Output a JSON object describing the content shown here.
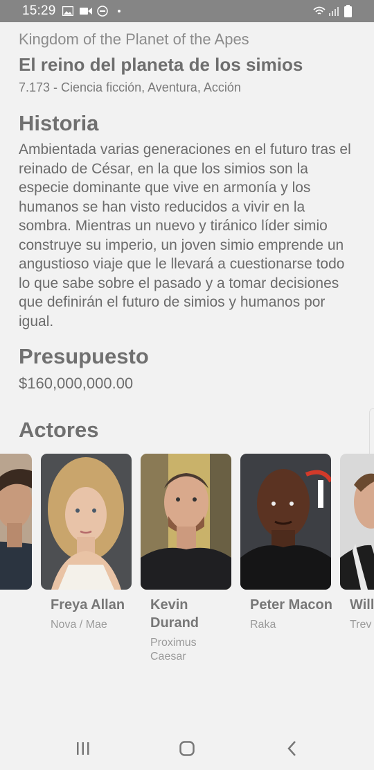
{
  "status_bar": {
    "time": "15:29"
  },
  "movie": {
    "original_title": "Kingdom of the Planet of the Apes",
    "title": "El reino del planeta de los simios",
    "meta": "7.173 - Ciencia ficción, Aventura, Acción"
  },
  "story": {
    "heading": "Historia",
    "text": "Ambientada varias generaciones en el futuro tras el reinado de César, en la que los simios son la especie dominante que vive en armonía y los humanos se han visto reducidos a vivir en la sombra. Mientras un nuevo y tiránico líder simio construye su imperio, un joven simio emprende un angustioso viaje que le llevará a cuestionarse todo lo que sabe sobre el pasado y a tomar decisiones que definirán el futuro de simios y humanos por igual."
  },
  "budget": {
    "heading": "Presupuesto",
    "value": "$160,000,000.00"
  },
  "cast": {
    "heading": "Actores",
    "actors": [
      {
        "name": "",
        "role": ""
      },
      {
        "name": "Freya Allan",
        "role": "Nova / Mae"
      },
      {
        "name": "Kevin Durand",
        "role": "Proximus Caesar"
      },
      {
        "name": "Peter Macon",
        "role": "Raka"
      },
      {
        "name": "Will Mac",
        "role": "Trev"
      }
    ]
  },
  "colors": {
    "status_bar": "#858585",
    "background": "#f2f2f2",
    "text": "#6b6b6b"
  }
}
